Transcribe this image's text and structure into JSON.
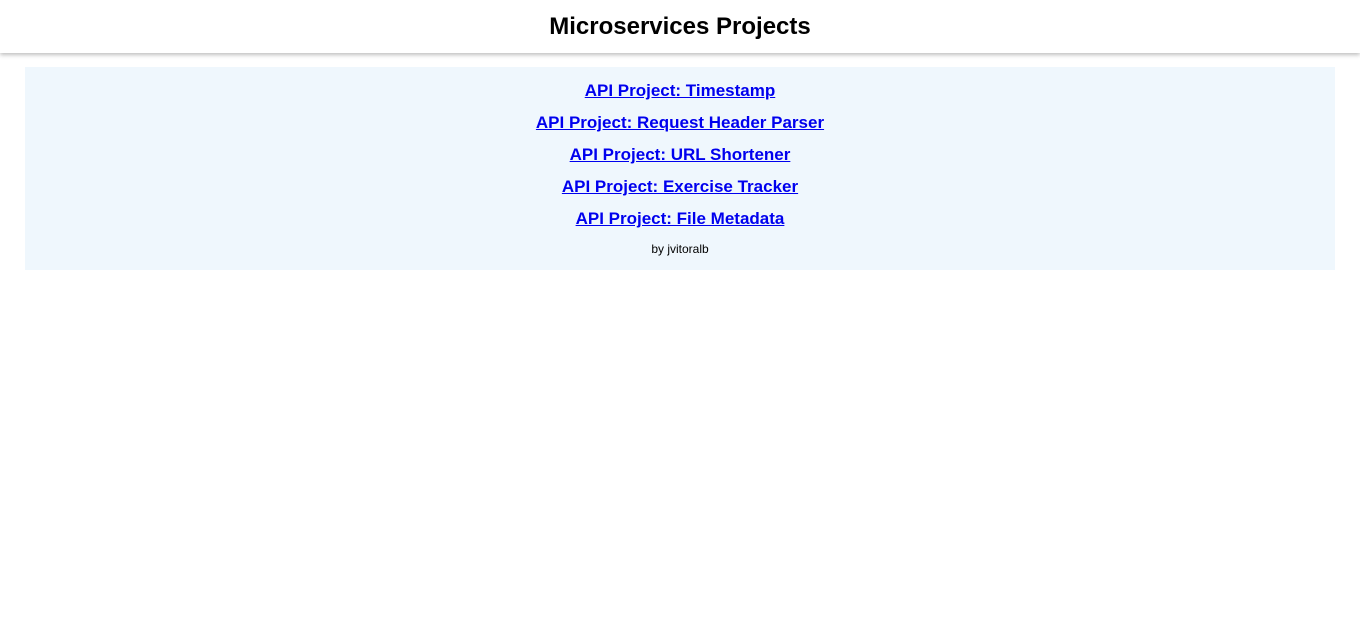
{
  "header": {
    "title": "Microservices Projects"
  },
  "projects": {
    "items": [
      {
        "label": "API Project: Timestamp"
      },
      {
        "label": "API Project: Request Header Parser"
      },
      {
        "label": "API Project: URL Shortener"
      },
      {
        "label": "API Project: Exercise Tracker"
      },
      {
        "label": "API Project: File Metadata"
      }
    ]
  },
  "footer": {
    "credit": "by jvitoralb"
  },
  "colors": {
    "link": "#0000ee",
    "panel_background": "#eff7fd"
  }
}
